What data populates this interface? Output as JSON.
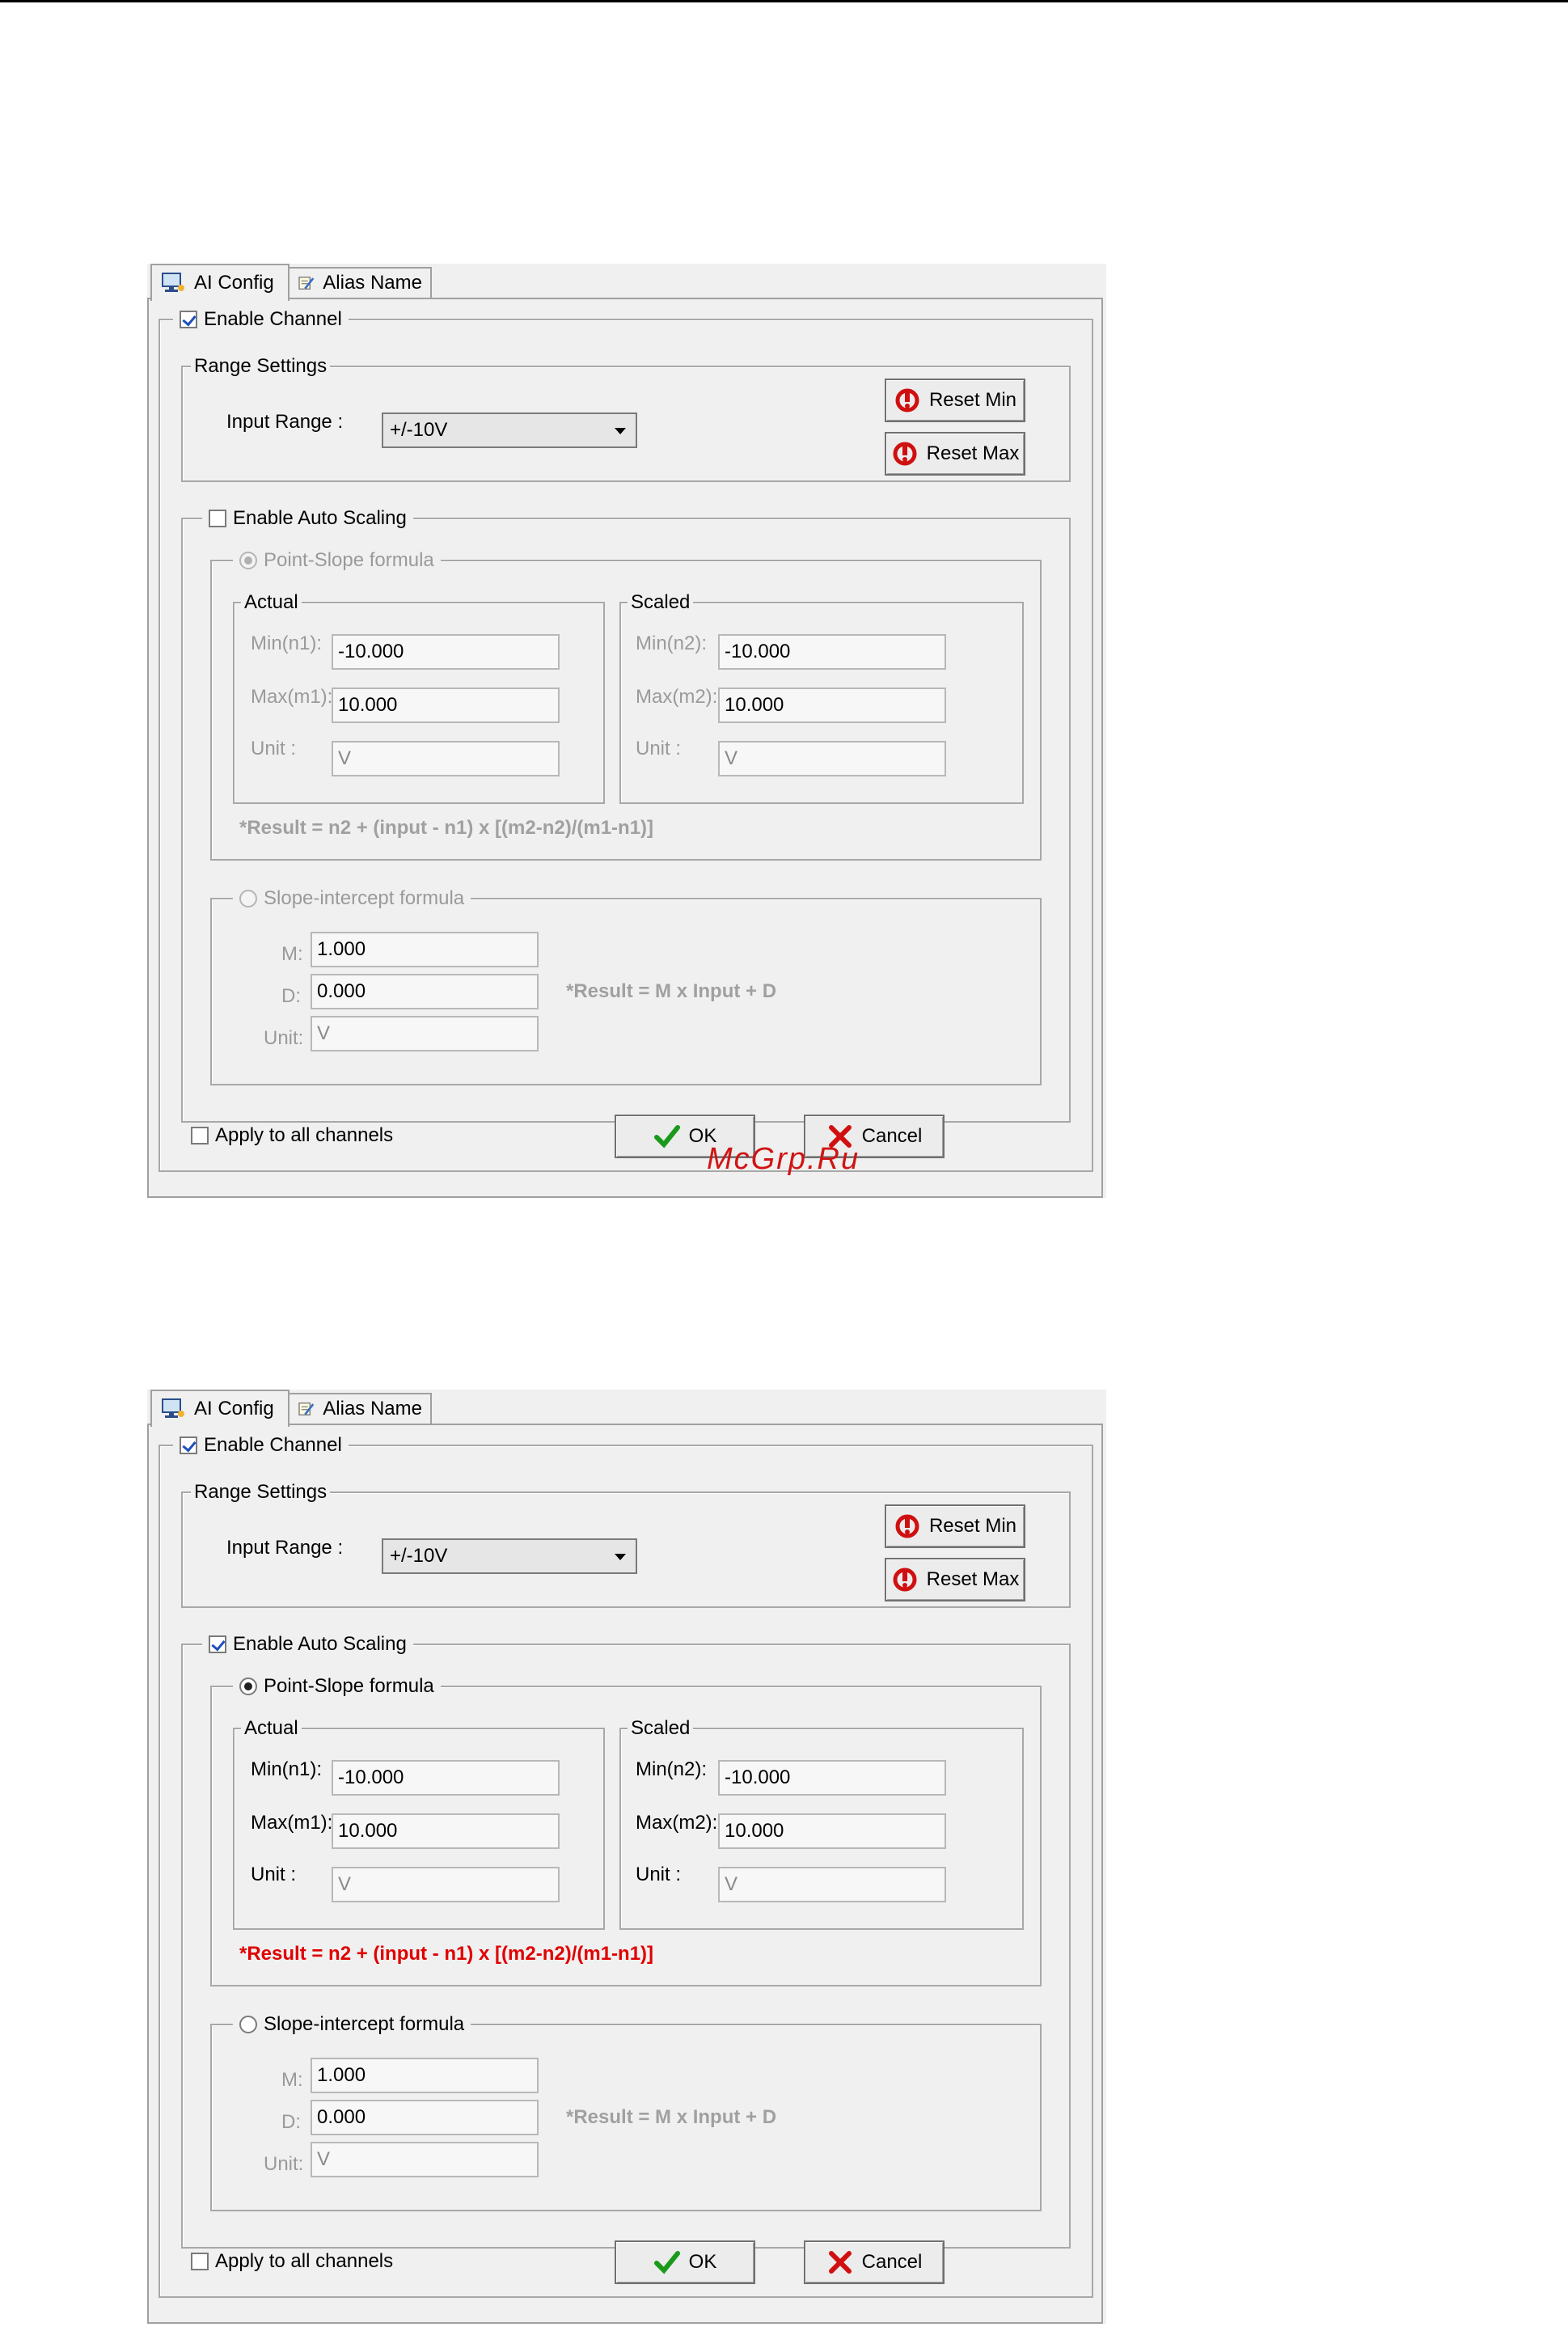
{
  "tabs": {
    "ai_config": "AI Config",
    "alias_name": "Alias Name"
  },
  "enable_channel": {
    "label": "Enable Channel"
  },
  "range_settings": {
    "title": "Range Settings",
    "input_range_label": "Input Range :",
    "input_range_value": "+/-10V",
    "reset_min": "Reset Min",
    "reset_max": "Reset Max"
  },
  "auto_scaling": {
    "label": "Enable Auto Scaling"
  },
  "point_slope": {
    "label": "Point-Slope formula",
    "actual_title": "Actual",
    "scaled_title": "Scaled",
    "min_n1_label": "Min(n1):",
    "max_m1_label": "Max(m1):",
    "unit_label": "Unit :",
    "min_n2_label": "Min(n2):",
    "max_m2_label": "Max(m2):",
    "min_n1": "-10.000",
    "max_m1": "10.000",
    "unit_actual": "V",
    "min_n2": "-10.000",
    "max_m2": "10.000",
    "unit_scaled": "V",
    "formula": "*Result = n2 + (input - n1) x [(m2-n2)/(m1-n1)]"
  },
  "slope_intercept": {
    "label": "Slope-intercept formula",
    "m_label": "M:",
    "d_label": "D:",
    "unit_label": "Unit:",
    "m": "1.000",
    "d": "0.000",
    "unit": "V",
    "formula": "*Result = M x Input + D"
  },
  "footer": {
    "apply_all": "Apply to all channels",
    "ok": "OK",
    "cancel": "Cancel"
  },
  "watermark": "McGrp.Ru",
  "dialogs": [
    {
      "id": "disabled-scaling",
      "auto_scaling_checked": false,
      "point_slope_selected": true
    },
    {
      "id": "enabled-scaling",
      "auto_scaling_checked": true,
      "point_slope_selected": true
    }
  ],
  "colors": {
    "formula_active": "#e00000",
    "disabled_text": "#9a9a9a",
    "check": "#1f4fbf"
  },
  "icons": {
    "ai_config_tab": "monitor-network-icon",
    "alias_tab": "notepad-pencil-icon",
    "reset": "red-reset-icon",
    "ok": "green-check-icon",
    "cancel": "red-x-icon"
  }
}
